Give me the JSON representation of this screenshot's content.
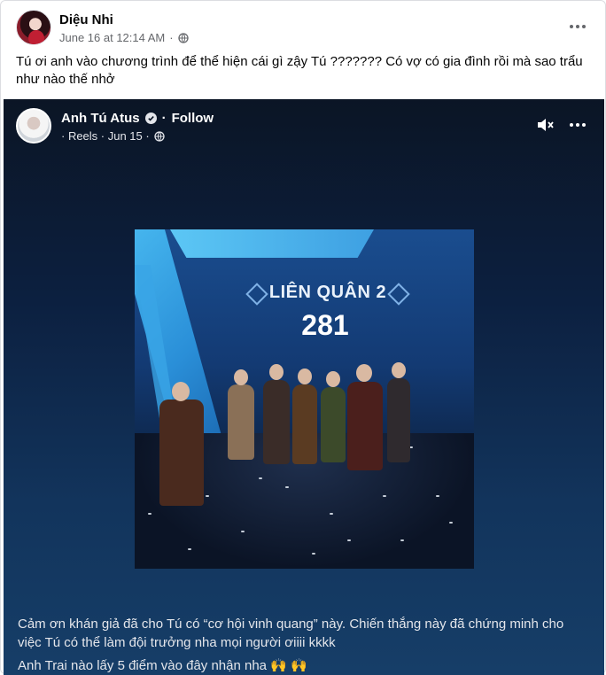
{
  "post": {
    "author": "Diệu Nhi",
    "timestamp": "June 16 at 12:14 AM",
    "separator": "·",
    "privacy_icon": "globe-icon",
    "more_icon": "more-dots-icon",
    "text": "Tú ơi anh vào chương trình để thể hiện cái gì zậy Tú ??????? Có vợ có gia đình rồi mà sao trẩu như nào thế nhở"
  },
  "shared_reel": {
    "author": "Anh Tú Atus",
    "verified_icon": "verified-badge-icon",
    "separator": "·",
    "follow_label": "Follow",
    "meta": "· Reels · Jun 15 ·",
    "privacy_icon": "globe-icon",
    "mute_icon": "speaker-muted-icon",
    "more_icon": "more-dots-icon",
    "video": {
      "stage_title": "LIÊN QUÂN 2",
      "stage_score": "281"
    },
    "caption": "Cảm ơn khán giả đã cho Tú có “cơ hội vinh quang” này. Chiến thắng này đã chứng minh cho việc Tú có thể làm đội trưởng nha mọi người ơiiii kkkk",
    "caption_line2": "Anh Trai nào lấy 5 điểm vào đây nhận nha 🙌 🙌"
  },
  "colors": {
    "reel_bg_top": "#0b1525",
    "reel_bg_bottom": "#163e68",
    "meta_gray": "#65676b",
    "text_dark": "#050505"
  }
}
